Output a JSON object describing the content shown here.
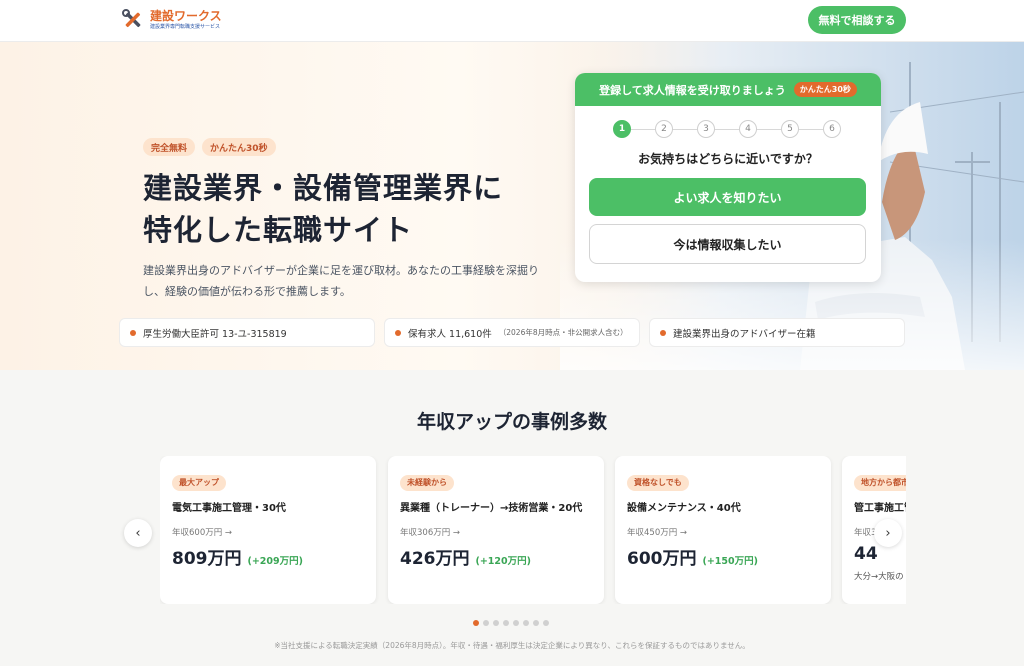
{
  "header": {
    "logo_text": "建設ワークス",
    "logo_sub": "建設業界専門転職支援サービス",
    "cta_label": "無料で相談する"
  },
  "hero": {
    "badges": [
      "完全無料",
      "かんたん30秒"
    ],
    "title_line1": "建設業界・設備管理業界に",
    "title_line2": "特化した転職サイト",
    "lead": "建設業界出身のアドバイザーが企業に足を運び取材。あなたの工事経験を深掘りし、経験の価値が伝わる形で推薦します。"
  },
  "form": {
    "header": "登録して求人情報を受け取りましょう",
    "header_badge": "かんたん30秒",
    "steps": [
      "1",
      "2",
      "3",
      "4",
      "5",
      "6"
    ],
    "current_step": 1,
    "question": "お気持ちはどちらに近いですか？",
    "option_primary": "よい求人を知りたい",
    "option_secondary": "今は情報収集したい"
  },
  "features": [
    {
      "text": "厚生労働大臣許可 13-ユ-315819",
      "note": ""
    },
    {
      "text": "保有求人 11,610件",
      "note": "（2026年8月時点・非公開求人含む）"
    },
    {
      "text": "建設業界出身のアドバイザー在籍",
      "note": ""
    }
  ],
  "cases": {
    "section_title": "年収アップの事例多数",
    "items": [
      {
        "tag": "最大アップ",
        "title": "電気工事施工管理・30代",
        "before": "年収600万円 →",
        "after": "809万円",
        "diff": "(+209万円)",
        "route": ""
      },
      {
        "tag": "未経験から",
        "title": "異業種（トレーナー）→技術営業・20代",
        "before": "年収306万円 →",
        "after": "426万円",
        "diff": "(+120万円)",
        "route": ""
      },
      {
        "tag": "資格なしでも",
        "title": "設備メンテナンス・40代",
        "before": "年収450万円 →",
        "after": "600万円",
        "diff": "(+150万円)",
        "route": ""
      },
      {
        "tag": "地方から都市",
        "title": "管工事施工管",
        "before": "年収3",
        "after": "44",
        "diff": "",
        "route": "大分→大阪の"
      }
    ],
    "prev_label": "‹",
    "next_label": "›",
    "page_count": 8,
    "active_page": 1,
    "footnote": "※当社支援による転職決定実績（2026年8月時点）。年収・待遇・福利厚生は決定企業により異なり、これらを保証するものではありません。"
  },
  "colors": {
    "brand_green": "#4cbf66",
    "brand_orange": "#e26a2c",
    "navy": "#1d2433"
  }
}
